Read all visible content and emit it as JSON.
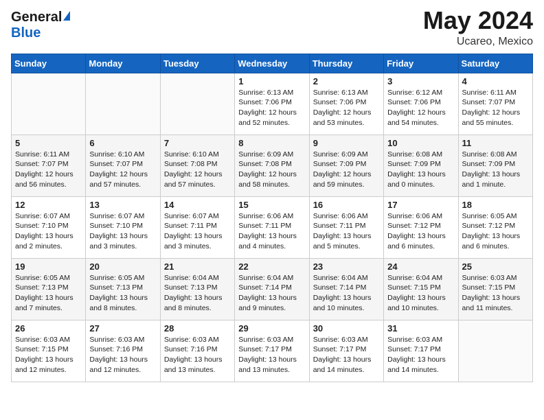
{
  "header": {
    "logo_line1": "General",
    "logo_line2": "Blue",
    "month": "May 2024",
    "location": "Ucareo, Mexico"
  },
  "weekdays": [
    "Sunday",
    "Monday",
    "Tuesday",
    "Wednesday",
    "Thursday",
    "Friday",
    "Saturday"
  ],
  "weeks": [
    [
      {
        "day": "",
        "info": ""
      },
      {
        "day": "",
        "info": ""
      },
      {
        "day": "",
        "info": ""
      },
      {
        "day": "1",
        "info": "Sunrise: 6:13 AM\nSunset: 7:06 PM\nDaylight: 12 hours\nand 52 minutes."
      },
      {
        "day": "2",
        "info": "Sunrise: 6:13 AM\nSunset: 7:06 PM\nDaylight: 12 hours\nand 53 minutes."
      },
      {
        "day": "3",
        "info": "Sunrise: 6:12 AM\nSunset: 7:06 PM\nDaylight: 12 hours\nand 54 minutes."
      },
      {
        "day": "4",
        "info": "Sunrise: 6:11 AM\nSunset: 7:07 PM\nDaylight: 12 hours\nand 55 minutes."
      }
    ],
    [
      {
        "day": "5",
        "info": "Sunrise: 6:11 AM\nSunset: 7:07 PM\nDaylight: 12 hours\nand 56 minutes."
      },
      {
        "day": "6",
        "info": "Sunrise: 6:10 AM\nSunset: 7:07 PM\nDaylight: 12 hours\nand 57 minutes."
      },
      {
        "day": "7",
        "info": "Sunrise: 6:10 AM\nSunset: 7:08 PM\nDaylight: 12 hours\nand 57 minutes."
      },
      {
        "day": "8",
        "info": "Sunrise: 6:09 AM\nSunset: 7:08 PM\nDaylight: 12 hours\nand 58 minutes."
      },
      {
        "day": "9",
        "info": "Sunrise: 6:09 AM\nSunset: 7:09 PM\nDaylight: 12 hours\nand 59 minutes."
      },
      {
        "day": "10",
        "info": "Sunrise: 6:08 AM\nSunset: 7:09 PM\nDaylight: 13 hours\nand 0 minutes."
      },
      {
        "day": "11",
        "info": "Sunrise: 6:08 AM\nSunset: 7:09 PM\nDaylight: 13 hours\nand 1 minute."
      }
    ],
    [
      {
        "day": "12",
        "info": "Sunrise: 6:07 AM\nSunset: 7:10 PM\nDaylight: 13 hours\nand 2 minutes."
      },
      {
        "day": "13",
        "info": "Sunrise: 6:07 AM\nSunset: 7:10 PM\nDaylight: 13 hours\nand 3 minutes."
      },
      {
        "day": "14",
        "info": "Sunrise: 6:07 AM\nSunset: 7:11 PM\nDaylight: 13 hours\nand 3 minutes."
      },
      {
        "day": "15",
        "info": "Sunrise: 6:06 AM\nSunset: 7:11 PM\nDaylight: 13 hours\nand 4 minutes."
      },
      {
        "day": "16",
        "info": "Sunrise: 6:06 AM\nSunset: 7:11 PM\nDaylight: 13 hours\nand 5 minutes."
      },
      {
        "day": "17",
        "info": "Sunrise: 6:06 AM\nSunset: 7:12 PM\nDaylight: 13 hours\nand 6 minutes."
      },
      {
        "day": "18",
        "info": "Sunrise: 6:05 AM\nSunset: 7:12 PM\nDaylight: 13 hours\nand 6 minutes."
      }
    ],
    [
      {
        "day": "19",
        "info": "Sunrise: 6:05 AM\nSunset: 7:13 PM\nDaylight: 13 hours\nand 7 minutes."
      },
      {
        "day": "20",
        "info": "Sunrise: 6:05 AM\nSunset: 7:13 PM\nDaylight: 13 hours\nand 8 minutes."
      },
      {
        "day": "21",
        "info": "Sunrise: 6:04 AM\nSunset: 7:13 PM\nDaylight: 13 hours\nand 8 minutes."
      },
      {
        "day": "22",
        "info": "Sunrise: 6:04 AM\nSunset: 7:14 PM\nDaylight: 13 hours\nand 9 minutes."
      },
      {
        "day": "23",
        "info": "Sunrise: 6:04 AM\nSunset: 7:14 PM\nDaylight: 13 hours\nand 10 minutes."
      },
      {
        "day": "24",
        "info": "Sunrise: 6:04 AM\nSunset: 7:15 PM\nDaylight: 13 hours\nand 10 minutes."
      },
      {
        "day": "25",
        "info": "Sunrise: 6:03 AM\nSunset: 7:15 PM\nDaylight: 13 hours\nand 11 minutes."
      }
    ],
    [
      {
        "day": "26",
        "info": "Sunrise: 6:03 AM\nSunset: 7:15 PM\nDaylight: 13 hours\nand 12 minutes."
      },
      {
        "day": "27",
        "info": "Sunrise: 6:03 AM\nSunset: 7:16 PM\nDaylight: 13 hours\nand 12 minutes."
      },
      {
        "day": "28",
        "info": "Sunrise: 6:03 AM\nSunset: 7:16 PM\nDaylight: 13 hours\nand 13 minutes."
      },
      {
        "day": "29",
        "info": "Sunrise: 6:03 AM\nSunset: 7:17 PM\nDaylight: 13 hours\nand 13 minutes."
      },
      {
        "day": "30",
        "info": "Sunrise: 6:03 AM\nSunset: 7:17 PM\nDaylight: 13 hours\nand 14 minutes."
      },
      {
        "day": "31",
        "info": "Sunrise: 6:03 AM\nSunset: 7:17 PM\nDaylight: 13 hours\nand 14 minutes."
      },
      {
        "day": "",
        "info": ""
      }
    ]
  ]
}
